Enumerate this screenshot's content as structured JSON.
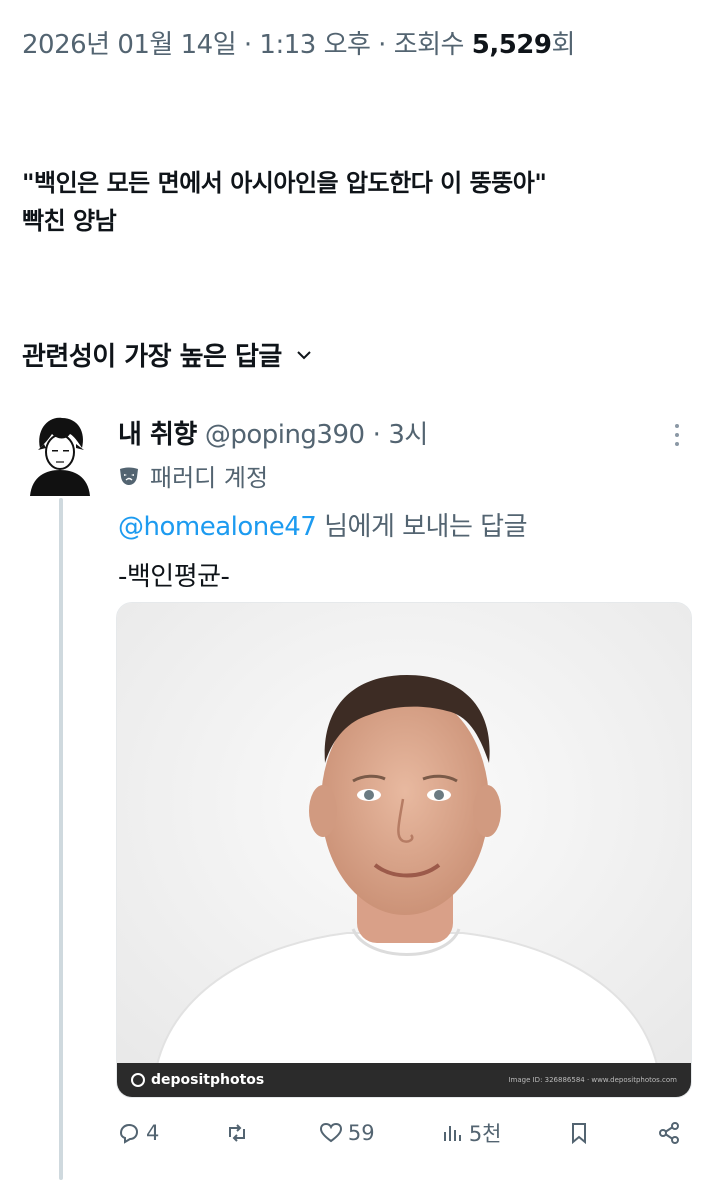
{
  "post_meta": {
    "date_time": "2026년 01월 14일 · 1:13 오후 · 조회수 ",
    "view_count": "5,529",
    "view_suffix": "회"
  },
  "post": {
    "text_line1": "\"백인은 모든 면에서 아시아인을 압도한다 이 뚱뚱아\"",
    "text_line2": "빡친 양남"
  },
  "replies_sort": {
    "label": "관련성이 가장 높은 답글",
    "icon": "chevron-down-icon"
  },
  "reply": {
    "display_name": "내 취향",
    "handle": "@poping390",
    "separator": "·",
    "time": "3시",
    "badge_icon": "mask-icon",
    "badge_label": "패러디 계정",
    "mention": "@homealone47",
    "replying_suffix": " 님에게 보내는 답글",
    "body": "-백인평균-",
    "media": {
      "watermark_brand": "depositphotos",
      "watermark_right": "Image ID: 326886584   ·   www.depositphotos.com"
    },
    "actions": {
      "replies": "4",
      "reposts": "",
      "likes": "59",
      "views": "5천"
    }
  },
  "colors": {
    "text_primary": "#0f1419",
    "text_secondary": "#536471",
    "link": "#1d9bf0",
    "thread_line": "#cfd9de"
  }
}
